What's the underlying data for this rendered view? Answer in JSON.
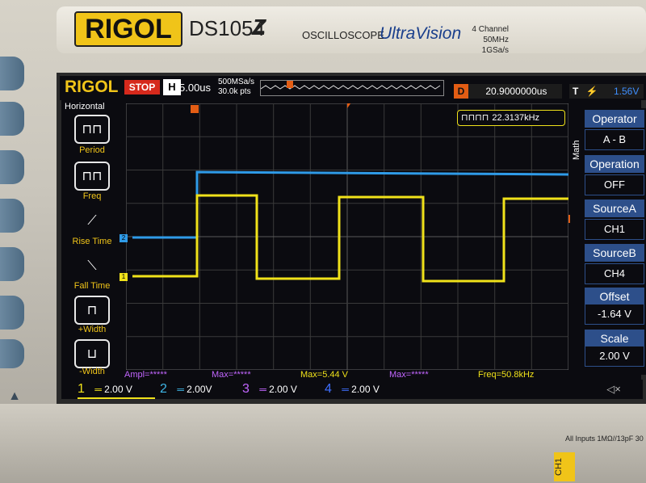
{
  "device": {
    "brand": "RIGOL",
    "model": "DS1054",
    "model_suffix": "Z",
    "type_label": "OSCILLOSCOPE",
    "series": "UltraVision",
    "channels_spec": "4 Channel",
    "bandwidth_spec": "50MHz  1GSa/s",
    "input_spec": "All Inputs 1MΩ//13pF 30",
    "ch1_connector": "CH1"
  },
  "status": {
    "logo": "RIGOL",
    "run_state": "STOP",
    "timebase_key": "H",
    "timebase": "5.00us",
    "sample_rate": "500MSa/s",
    "points": "30.0k pts",
    "delay_key": "D",
    "delay": "20.9000000us",
    "trigger_key": "T",
    "trigger_level": "1.56V"
  },
  "left_menu": {
    "title": "Horizontal",
    "items": [
      {
        "label": "Period",
        "icon": "period-icon"
      },
      {
        "label": "Freq",
        "icon": "freq-icon"
      },
      {
        "label": "Rise Time",
        "icon": "rise-time-icon"
      },
      {
        "label": "Fall Time",
        "icon": "fall-time-icon"
      },
      {
        "label": "+Width",
        "icon": "pos-width-icon"
      },
      {
        "label": "-Width",
        "icon": "neg-width-icon"
      }
    ]
  },
  "freq_counter": "22.3137kHz",
  "right_menu": {
    "math_label": "Math",
    "items": [
      {
        "head": "Operator",
        "value": "A - B"
      },
      {
        "head": "Operation",
        "value": "OFF"
      },
      {
        "head": "SourceA",
        "value": "CH1"
      },
      {
        "head": "SourceB",
        "value": "CH4"
      },
      {
        "head": "Offset",
        "value": "-1.64 V"
      },
      {
        "head": "Scale",
        "value": "2.00 V"
      }
    ]
  },
  "measurements": [
    {
      "text": "Ampl=*****",
      "color": "#c266ff"
    },
    {
      "text": "Max=*****",
      "color": "#c266ff"
    },
    {
      "text": "Max=5.44 V",
      "color": "#f0e21a"
    },
    {
      "text": "Max=*****",
      "color": "#c266ff"
    },
    {
      "text": "Freq=50.8kHz",
      "color": "#f0e21a"
    }
  ],
  "channels": [
    {
      "num": "1",
      "scale": "2.00 V",
      "color": "#f0e21a"
    },
    {
      "num": "2",
      "scale": "2.00V",
      "color": "#3fb7e8"
    },
    {
      "num": "3",
      "scale": "2.00 V",
      "color": "#c266ff"
    },
    {
      "num": "4",
      "scale": "2.00 V",
      "color": "#3f6fff"
    }
  ],
  "markers": {
    "ch1": "1",
    "ch2": "2",
    "trigger": "T"
  },
  "colors": {
    "ch1": "#f0e21a",
    "ch2": "#2f9be8",
    "trigger": "#e35d14",
    "menu_head": "#2d4f8a"
  }
}
